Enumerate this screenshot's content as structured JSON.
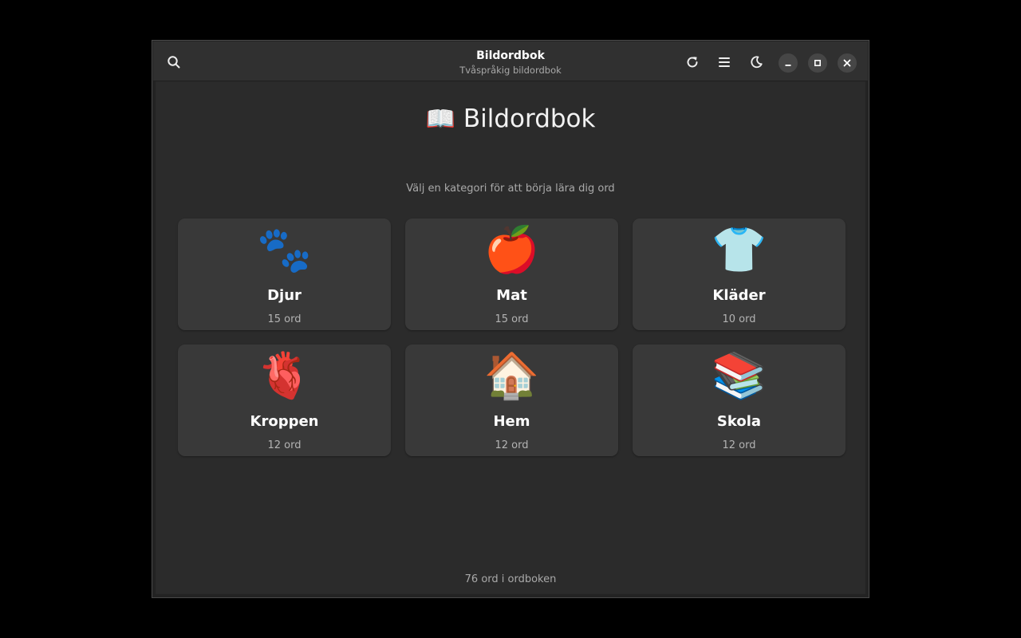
{
  "window": {
    "title": "Bildordbok",
    "subtitle": "Tvåspråkig bildordbok"
  },
  "headerbar": {
    "search_icon": "search-icon",
    "refresh_icon": "refresh-icon",
    "menu_icon": "hamburger-menu-icon",
    "theme_icon": "moon-icon",
    "minimize_icon": "minimize-icon",
    "maximize_icon": "maximize-icon",
    "close_icon": "close-icon"
  },
  "main": {
    "title_emoji": "📖",
    "title": "Bildordbok",
    "subtitle": "Välj en kategori för att börja lära dig ord"
  },
  "categories": [
    {
      "emoji": "🐾",
      "label": "Djur",
      "count": "15 ord"
    },
    {
      "emoji": "🍎",
      "label": "Mat",
      "count": "15 ord"
    },
    {
      "emoji": "👕",
      "label": "Kläder",
      "count": "10 ord"
    },
    {
      "emoji": "🫀",
      "label": "Kroppen",
      "count": "12 ord"
    },
    {
      "emoji": "🏠",
      "label": "Hem",
      "count": "12 ord"
    },
    {
      "emoji": "📚",
      "label": "Skola",
      "count": "12 ord"
    }
  ],
  "footer": {
    "text": "76 ord i ordboken"
  },
  "colors": {
    "background": "#000000",
    "window": "#2a2a2a",
    "headerbar": "#303030",
    "card": "#393939",
    "muted_text": "#a9a9a9"
  }
}
